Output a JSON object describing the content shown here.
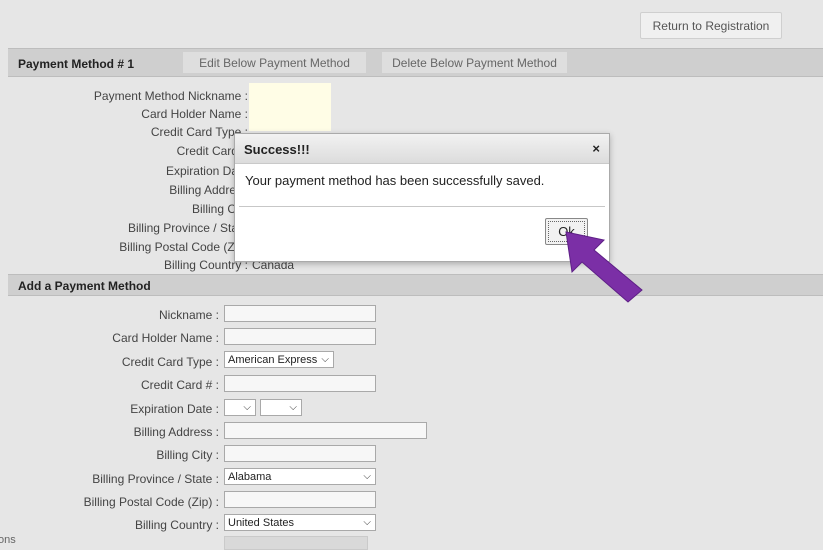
{
  "top": {
    "return_button": "Return to Registration"
  },
  "payment_section": {
    "title": "Payment Method # 1",
    "edit_button": "Edit Below Payment Method",
    "delete_button": "Delete Below Payment Method",
    "fields": [
      {
        "label": "Payment Method Nickname :",
        "value": ""
      },
      {
        "label": "Card Holder Name :",
        "value": ""
      },
      {
        "label": "Credit Card Type :",
        "value": ""
      },
      {
        "label": "Credit Card #",
        "value": ""
      },
      {
        "label": "Expiration Date",
        "value": ""
      },
      {
        "label": "Billing Address",
        "value": ""
      },
      {
        "label": "Billing City",
        "value": ""
      },
      {
        "label": "Billing Province / State",
        "value": ""
      },
      {
        "label": "Billing Postal Code (Zip)",
        "value": ""
      },
      {
        "label": "Billing Country :",
        "value": "Canada"
      }
    ]
  },
  "add_section": {
    "title": "Add a Payment Method",
    "labels": {
      "nickname": "Nickname :",
      "holder": "Card Holder Name :",
      "card_type": "Credit Card Type :",
      "card_number": "Credit Card # :",
      "expiration": "Expiration Date :",
      "address": "Billing Address :",
      "city": "Billing City :",
      "province": "Billing Province / State :",
      "postal": "Billing Postal Code (Zip) :",
      "country": "Billing Country :"
    },
    "values": {
      "card_type": "American Express",
      "province": "Alabama",
      "country": "United States"
    }
  },
  "modal": {
    "title": "Success!!!",
    "close_glyph": "×",
    "message": "Your payment method has been successfully saved.",
    "ok_button": "Ok"
  },
  "corner_text": "ons",
  "colors": {
    "arrow": "#7b2fa6",
    "nickname_value_bg": "#fffde6"
  }
}
